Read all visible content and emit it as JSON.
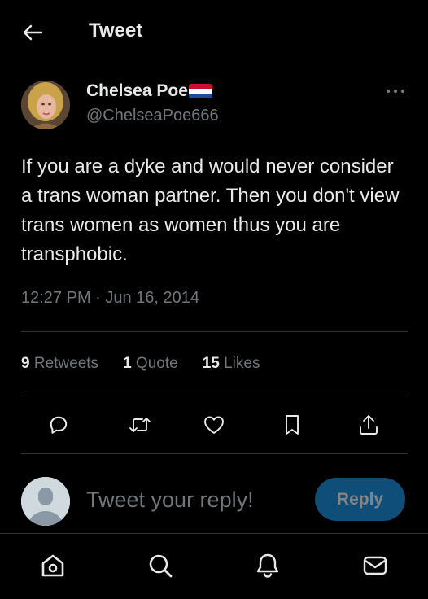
{
  "header": {
    "title": "Tweet",
    "back_icon": "arrow-left-icon"
  },
  "author": {
    "display_name": "Chelsea Poe",
    "flag_icon": "netherlands-flag-icon",
    "handle": "@ChelseaPoe666"
  },
  "more_icon": "more-horizontal-icon",
  "tweet": {
    "text": "If you are a dyke and would never consider a trans woman partner. Then you don't view trans women as women thus you are transphobic.",
    "timestamp": "12:27 PM · Jun 16, 2014"
  },
  "stats": {
    "retweets_count": "9",
    "retweets_label": "Retweets",
    "quotes_count": "1",
    "quotes_label": "Quote",
    "likes_count": "15",
    "likes_label": "Likes"
  },
  "actions": [
    "reply-icon",
    "retweet-icon",
    "like-icon",
    "bookmark-icon",
    "share-icon"
  ],
  "reply": {
    "placeholder": "Tweet your reply!",
    "button_label": "Reply"
  },
  "bottom_nav": [
    "home-icon",
    "search-icon",
    "notifications-icon",
    "messages-icon"
  ],
  "colors": {
    "background": "#000000",
    "primary_text": "#e7e9ea",
    "secondary_text": "#71767b",
    "divider": "#2f3336",
    "reply_button_disabled": "#0f4e78"
  }
}
